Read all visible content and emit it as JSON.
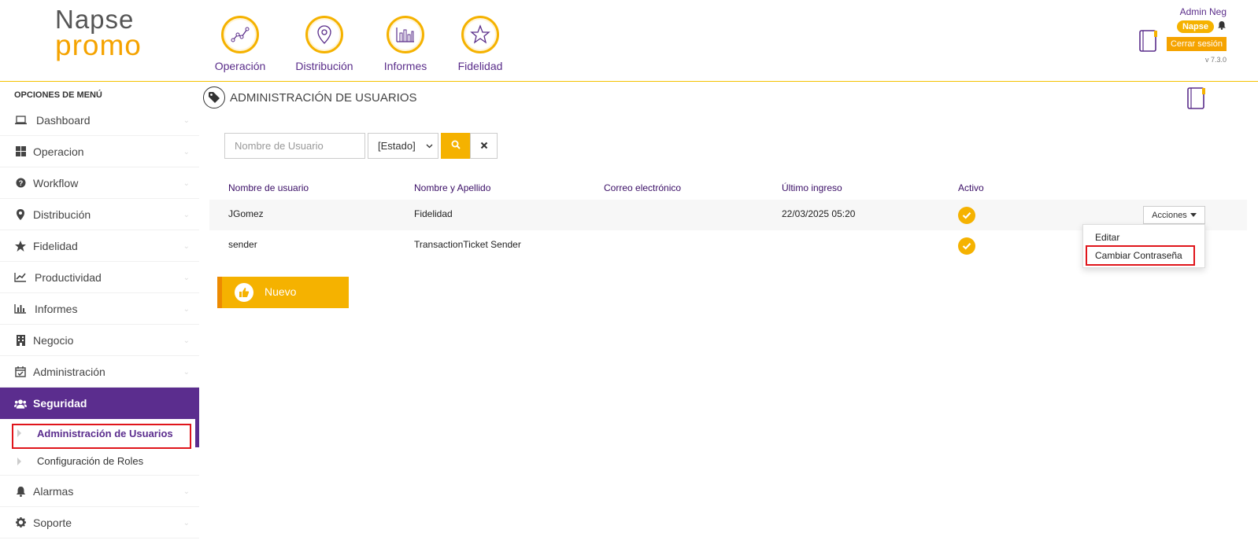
{
  "brand": {
    "line1": "Napse",
    "line2": "promo"
  },
  "nav": [
    {
      "label": "Operación",
      "icon": "line-chart-icon"
    },
    {
      "label": "Distribución",
      "icon": "map-pin-icon"
    },
    {
      "label": "Informes",
      "icon": "bar-chart-icon"
    },
    {
      "label": "Fidelidad",
      "icon": "star-icon"
    }
  ],
  "user": {
    "name": "Admin Neg",
    "badge": "Napse",
    "logout": "Cerrar sesión",
    "version": "v 7.3.0"
  },
  "sidebar": {
    "heading": "OPCIONES DE MENÚ",
    "items": [
      {
        "label": "Dashboard",
        "icon": "laptop-icon"
      },
      {
        "label": "Operacion",
        "icon": "grid-icon"
      },
      {
        "label": "Workflow",
        "icon": "question-circle-icon"
      },
      {
        "label": "Distribución",
        "icon": "map-marker-icon"
      },
      {
        "label": "Fidelidad",
        "icon": "star-icon"
      },
      {
        "label": "Productividad",
        "icon": "line-chart-icon"
      },
      {
        "label": "Informes",
        "icon": "bar-chart-icon"
      },
      {
        "label": "Negocio",
        "icon": "building-icon"
      },
      {
        "label": "Administración",
        "icon": "calendar-check-icon"
      },
      {
        "label": "Seguridad",
        "icon": "users-icon",
        "active": true
      },
      {
        "label": "Alarmas",
        "icon": "bell-icon"
      },
      {
        "label": "Soporte",
        "icon": "gear-icon"
      }
    ],
    "subitems": [
      {
        "label": "Administración de Usuarios",
        "current": true
      },
      {
        "label": "Configuración de Roles"
      }
    ]
  },
  "page": {
    "title": "ADMINISTRACIÓN DE USUARIOS"
  },
  "filters": {
    "username_placeholder": "Nombre de Usuario",
    "estado_value": "[Estado]"
  },
  "table": {
    "columns": [
      "Nombre de usuario",
      "Nombre y Apellido",
      "Correo electrónico",
      "Último ingreso",
      "Activo"
    ],
    "rows": [
      {
        "username": "JGomez",
        "fullname": "Fidelidad",
        "email": "",
        "last_login": "22/03/2025 05:20",
        "active": true
      },
      {
        "username": "sender",
        "fullname": "TransactionTicket Sender",
        "email": "",
        "last_login": "",
        "active": true
      }
    ],
    "actions_label": "Acciones"
  },
  "actions_menu": [
    "Editar",
    "Cambiar Contraseña"
  ],
  "new_button": "Nuevo",
  "colors": {
    "primary_purple": "#5b2d8e",
    "accent_orange": "#f5b200",
    "highlight_red": "#e0151b"
  }
}
